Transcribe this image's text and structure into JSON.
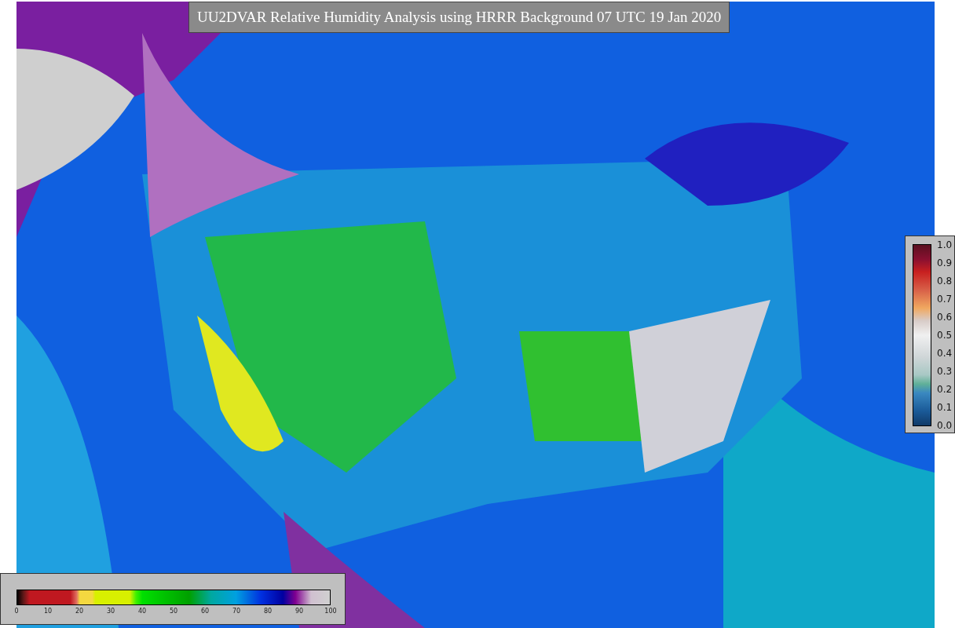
{
  "title": "UU2DVAR Relative Humidity Analysis using HRRR Background 07 UTC 19 Jan 2020",
  "humidity_colorbar": {
    "ticks": [
      "0",
      "10",
      "20",
      "30",
      "40",
      "50",
      "60",
      "70",
      "80",
      "90",
      "100"
    ]
  },
  "value_colorbar": {
    "ticks": [
      "1.0",
      "0.9",
      "0.8",
      "0.7",
      "0.6",
      "0.5",
      "0.4",
      "0.3",
      "0.2",
      "0.1",
      "0.0"
    ]
  }
}
